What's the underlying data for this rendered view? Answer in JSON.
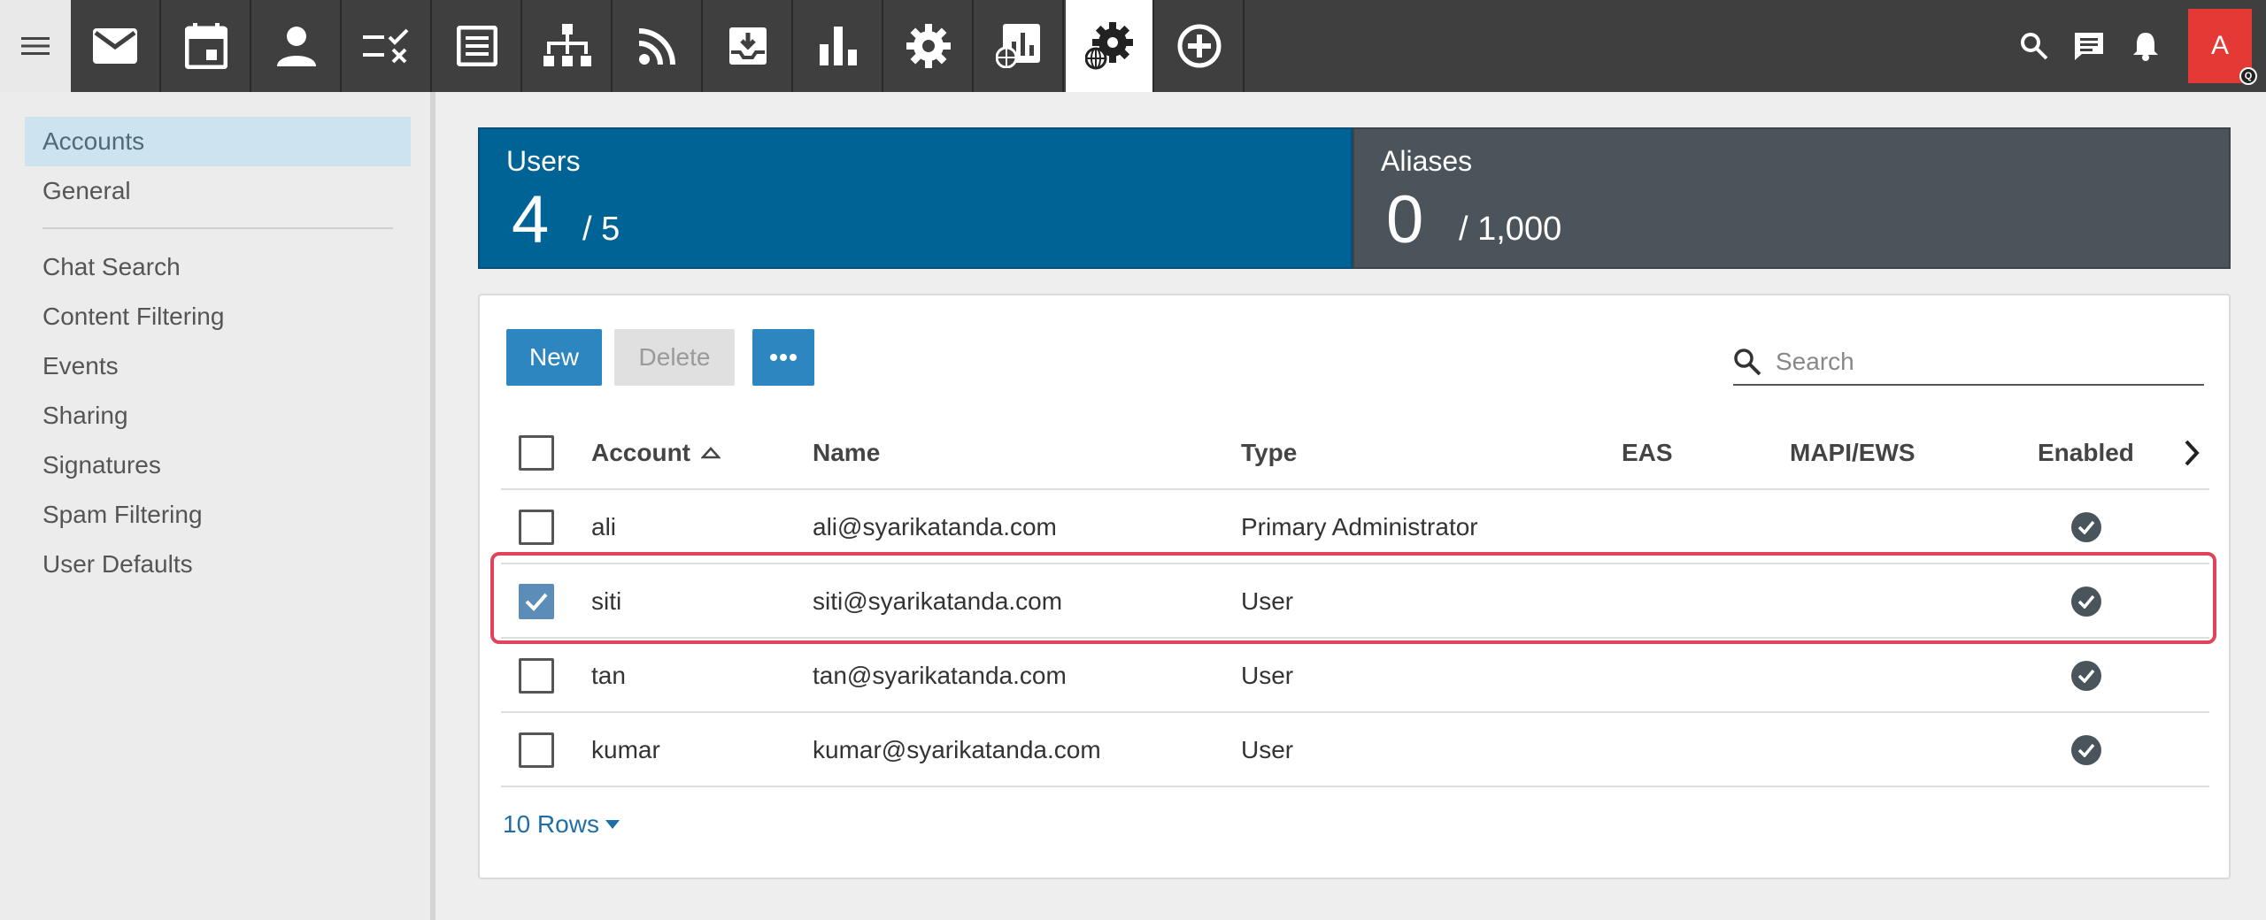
{
  "topbar": {
    "icons": [
      "menu-icon",
      "mail-icon",
      "calendar-icon",
      "contacts-icon",
      "tasks-icon",
      "notes-icon",
      "org-chart-icon",
      "rss-icon",
      "archive-icon",
      "reports-icon",
      "settings-icon",
      "domain-reports-icon",
      "domain-settings-icon",
      "add-icon"
    ],
    "right_icons": [
      "search-icon",
      "chat-icon",
      "bell-icon"
    ],
    "avatar_letter": "A",
    "avatar_badge": "Q",
    "avatar_color": "#e53935"
  },
  "sidebar": {
    "items": [
      {
        "label": "Accounts",
        "active": true
      },
      {
        "label": "General"
      },
      {
        "label": "Chat Search"
      },
      {
        "label": "Content Filtering"
      },
      {
        "label": "Events"
      },
      {
        "label": "Sharing"
      },
      {
        "label": "Signatures"
      },
      {
        "label": "Spam Filtering"
      },
      {
        "label": "User Defaults"
      }
    ]
  },
  "stats": {
    "users": {
      "label": "Users",
      "count": "4",
      "limit": "/ 5",
      "color": "#006396"
    },
    "aliases": {
      "label": "Aliases",
      "count": "0",
      "limit": "/ 1,000",
      "color": "#4b545b"
    }
  },
  "toolbar": {
    "new_label": "New",
    "delete_label": "Delete",
    "more_icon": "more-icon",
    "search_placeholder": "Search"
  },
  "table": {
    "columns": {
      "account": "Account",
      "name": "Name",
      "type": "Type",
      "eas": "EAS",
      "mapi": "MAPI/EWS",
      "enabled": "Enabled"
    },
    "sort": {
      "column": "account",
      "direction": "ascending"
    },
    "rows": [
      {
        "account": "ali",
        "name": "ali@syarikatanda.com",
        "type": "Primary Administrator",
        "eas": "",
        "mapi": "",
        "enabled": true,
        "checked": false
      },
      {
        "account": "siti",
        "name": "siti@syarikatanda.com",
        "type": "User",
        "eas": "",
        "mapi": "",
        "enabled": true,
        "checked": true
      },
      {
        "account": "tan",
        "name": "tan@syarikatanda.com",
        "type": "User",
        "eas": "",
        "mapi": "",
        "enabled": true,
        "checked": false
      },
      {
        "account": "kumar",
        "name": "kumar@syarikatanda.com",
        "type": "User",
        "eas": "",
        "mapi": "",
        "enabled": true,
        "checked": false
      }
    ],
    "rows_per_page": "10 Rows",
    "highlight_color": "#e0435a"
  }
}
